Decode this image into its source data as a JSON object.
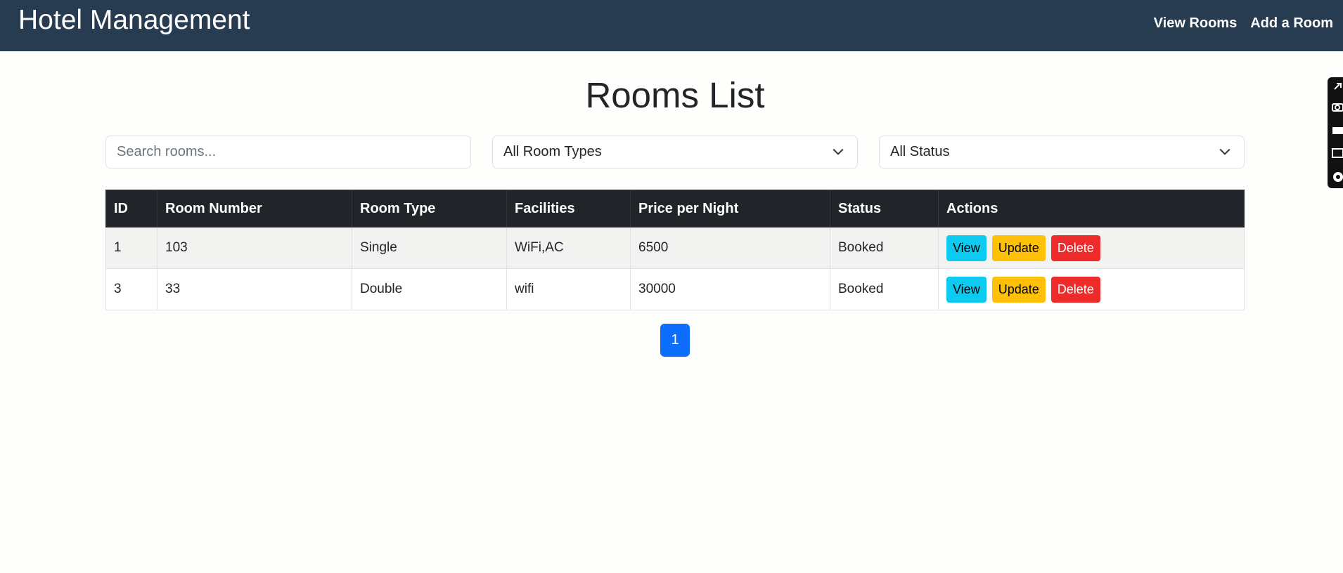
{
  "navbar": {
    "brand": "Hotel Management",
    "links": [
      "View Rooms",
      "Add a Room"
    ]
  },
  "main": {
    "title": "Rooms List",
    "search_placeholder": "Search rooms...",
    "room_type_filter": "All Room Types",
    "status_filter": "All Status"
  },
  "table": {
    "headers": [
      "ID",
      "Room Number",
      "Room Type",
      "Facilities",
      "Price per Night",
      "Status",
      "Actions"
    ],
    "rows": [
      {
        "id": "1",
        "room_number": "103",
        "room_type": "Single",
        "facilities": "WiFi,AC",
        "price": "6500",
        "status": "Booked"
      },
      {
        "id": "3",
        "room_number": "33",
        "room_type": "Double",
        "facilities": "wifi",
        "price": "30000",
        "status": "Booked"
      }
    ],
    "actions": {
      "view": "View",
      "update": "Update",
      "delete": "Delete"
    }
  },
  "pagination": {
    "current_page": "1"
  },
  "colors": {
    "navbar": "#283c51",
    "table_header": "#212529",
    "view_button": "#0dcaf0",
    "update_button": "#ffc107",
    "delete_button": "#ee2b2b",
    "page_active": "#0d6efd"
  },
  "side_widget": {
    "icons": [
      "link-icon",
      "camera-icon",
      "rectangle-icon",
      "window-icon",
      "gear-icon"
    ]
  }
}
